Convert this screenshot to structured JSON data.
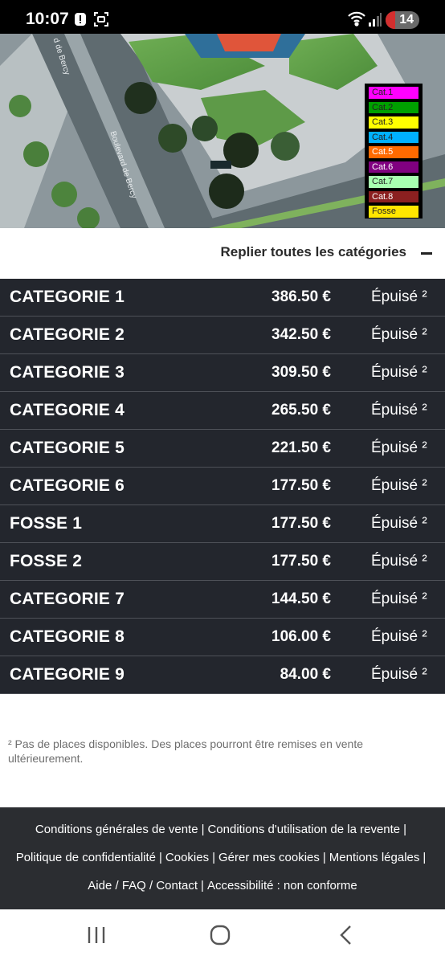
{
  "status_bar": {
    "time": "10:07",
    "battery": "14",
    "battery_color": "#d32f2f"
  },
  "map": {
    "street_label_1": "Boulevard de Bercy",
    "street_label_2": "d de Bercy",
    "legend": [
      {
        "label": "Cat.1",
        "color": "#ff00ff"
      },
      {
        "label": "Cat.2",
        "color": "#00a000"
      },
      {
        "label": "Cat.3",
        "color": "#ffff00"
      },
      {
        "label": "Cat.4",
        "color": "#00b0ff"
      },
      {
        "label": "Cat.5",
        "color": "#ff6a00"
      },
      {
        "label": "Cat.6",
        "color": "#800080"
      },
      {
        "label": "Cat.7",
        "color": "#a8ffb0"
      },
      {
        "label": "Cat.8",
        "color": "#8b2020"
      },
      {
        "label": "Fosse",
        "color": "#ffe600"
      }
    ]
  },
  "collapse": {
    "label": "Replier toutes les catégories"
  },
  "categories": [
    {
      "name": "CATEGORIE 1",
      "price": "386.50 €",
      "status": "Épuisé ²"
    },
    {
      "name": "CATEGORIE 2",
      "price": "342.50 €",
      "status": "Épuisé ²"
    },
    {
      "name": "CATEGORIE 3",
      "price": "309.50 €",
      "status": "Épuisé ²"
    },
    {
      "name": "CATEGORIE 4",
      "price": "265.50 €",
      "status": "Épuisé ²"
    },
    {
      "name": "CATEGORIE 5",
      "price": "221.50 €",
      "status": "Épuisé ²"
    },
    {
      "name": "CATEGORIE 6",
      "price": "177.50 €",
      "status": "Épuisé ²"
    },
    {
      "name": "FOSSE 1",
      "price": "177.50 €",
      "status": "Épuisé ²"
    },
    {
      "name": "FOSSE 2",
      "price": "177.50 €",
      "status": "Épuisé ²"
    },
    {
      "name": "CATEGORIE 7",
      "price": "144.50 €",
      "status": "Épuisé ²"
    },
    {
      "name": "CATEGORIE 8",
      "price": "106.00 €",
      "status": "Épuisé ²"
    },
    {
      "name": "CATEGORIE 9",
      "price": "84.00 €",
      "status": "Épuisé ²"
    }
  ],
  "footnote": "² Pas de places disponibles. Des places pourront être remises en vente ultérieurement.",
  "footer": {
    "links": [
      "Conditions générales de vente",
      "Conditions d'utilisation de la revente",
      "Politique de confidentialité",
      "Cookies",
      "Gérer mes cookies",
      "Mentions légales",
      "Aide / FAQ / Contact",
      "Accessibilité : non conforme"
    ]
  }
}
